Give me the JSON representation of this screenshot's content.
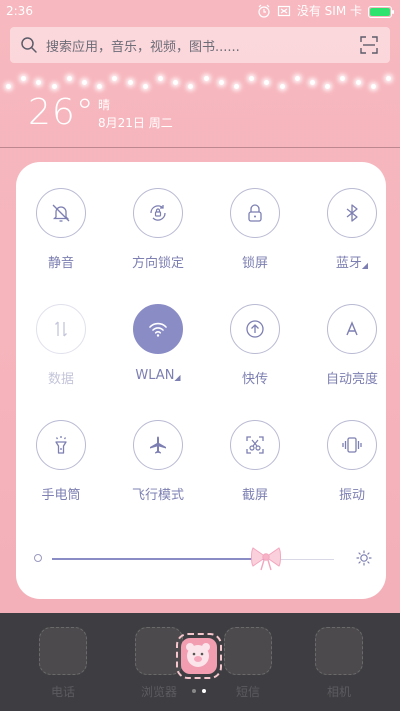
{
  "status_bar": {
    "time": "2:36",
    "carrier": "没有 SIM 卡",
    "battery_level": 1.0,
    "battery_color": "#2fe36f"
  },
  "search": {
    "placeholder": "搜索应用，音乐，视频，图书......",
    "search_icon": "search-icon",
    "scan_icon": "scan-icon"
  },
  "weather": {
    "temperature": "26°",
    "condition": "晴",
    "date": "8月21日 周二"
  },
  "control_center": {
    "accent_color": "#8a8cc6",
    "tiles": [
      {
        "label": "静音",
        "icon": "bell-mute-icon",
        "active": false,
        "disabled": false
      },
      {
        "label": "方向锁定",
        "icon": "rotation-lock-icon",
        "active": false,
        "disabled": false
      },
      {
        "label": "锁屏",
        "icon": "lock-icon",
        "active": false,
        "disabled": false
      },
      {
        "label": "蓝牙",
        "icon": "bluetooth-icon",
        "active": false,
        "disabled": false,
        "has_more": true
      },
      {
        "label": "数据",
        "icon": "mobile-data-icon",
        "active": false,
        "disabled": true
      },
      {
        "label": "WLAN",
        "icon": "wifi-icon",
        "active": true,
        "disabled": false,
        "has_more": true
      },
      {
        "label": "快传",
        "icon": "quick-transfer-icon",
        "active": false,
        "disabled": false
      },
      {
        "label": "自动亮度",
        "icon": "auto-brightness-icon",
        "active": false,
        "disabled": false
      },
      {
        "label": "手电筒",
        "icon": "flashlight-icon",
        "active": false,
        "disabled": false
      },
      {
        "label": "飞行模式",
        "icon": "airplane-icon",
        "active": false,
        "disabled": false
      },
      {
        "label": "截屏",
        "icon": "screenshot-icon",
        "active": false,
        "disabled": false
      },
      {
        "label": "振动",
        "icon": "vibrate-icon",
        "active": false,
        "disabled": false
      }
    ],
    "more_indicator": "◢",
    "brightness": 0.76
  },
  "dock": {
    "apps": [
      {
        "name": "电话"
      },
      {
        "name": "浏览器"
      },
      {
        "name": "短信"
      },
      {
        "name": "相机"
      }
    ],
    "pages": 2,
    "current_page": 2
  }
}
